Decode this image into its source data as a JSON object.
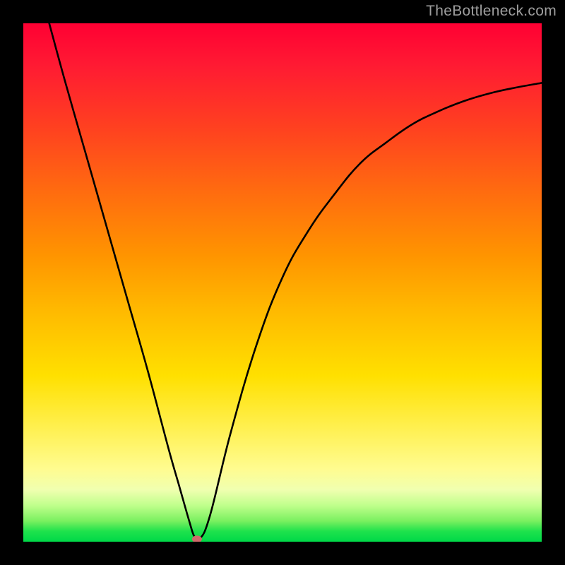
{
  "watermark": "TheBottleneck.com",
  "chart_data": {
    "type": "line",
    "title": "",
    "xlabel": "",
    "ylabel": "",
    "xlim": [
      0,
      100
    ],
    "ylim": [
      0,
      100
    ],
    "grid": false,
    "legend": false,
    "x": [
      5,
      8,
      12,
      16,
      20,
      24,
      28,
      30,
      32,
      33,
      34,
      36,
      40,
      45,
      50,
      55,
      60,
      65,
      70,
      75,
      80,
      85,
      90,
      95,
      100
    ],
    "y": [
      100,
      89,
      75,
      61,
      47,
      33,
      18,
      11,
      4,
      1,
      0.5,
      5,
      21,
      38,
      51,
      60,
      67,
      73,
      77,
      80.5,
      83,
      85,
      86.5,
      87.6,
      88.5
    ],
    "marker": {
      "x": 33.5,
      "y": 0.5,
      "color": "#cf6a6a"
    },
    "background_gradient": {
      "orientation": "vertical",
      "stops": [
        {
          "pos": 0.0,
          "color": "#ff0033"
        },
        {
          "pos": 0.45,
          "color": "#ff9500"
        },
        {
          "pos": 0.78,
          "color": "#fff050"
        },
        {
          "pos": 1.0,
          "color": "#00d848"
        }
      ]
    }
  }
}
